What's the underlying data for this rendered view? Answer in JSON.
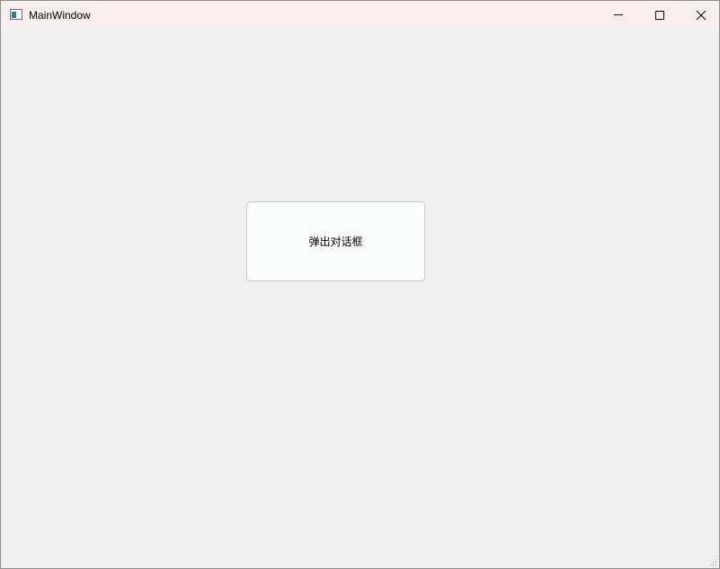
{
  "window": {
    "title": "MainWindow",
    "controls": {
      "minimize": "minimize-icon",
      "maximize": "maximize-icon",
      "close": "close-icon"
    }
  },
  "main": {
    "button_label": "弹出对话框"
  },
  "colors": {
    "titlebar_bg": "#f9eeee",
    "client_bg": "#f0f0f0",
    "button_bg": "#fbfdfc",
    "button_border": "#c8c8c8"
  }
}
